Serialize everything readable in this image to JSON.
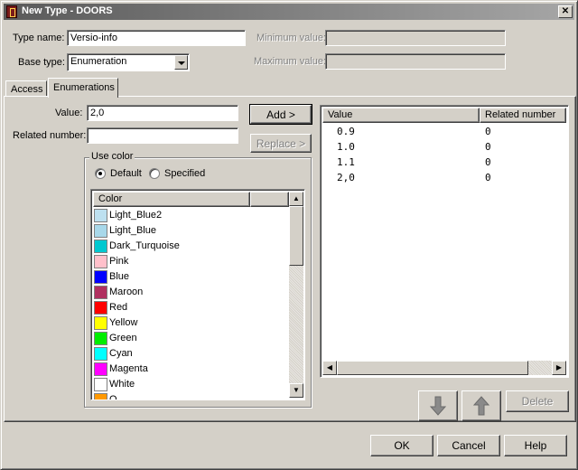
{
  "window": {
    "title": "New Type - DOORS",
    "close_glyph": "✕"
  },
  "form": {
    "type_name_label": "Type name:",
    "type_name_value": "Versio-info",
    "base_type_label": "Base type:",
    "base_type_value": "Enumeration",
    "minimum_label": "Minimum value:",
    "minimum_value": "",
    "maximum_label": "Maximum value:",
    "maximum_value": ""
  },
  "tabs": [
    {
      "label": "Access",
      "active": false
    },
    {
      "label": "Enumerations",
      "active": true
    }
  ],
  "enum": {
    "value_label": "Value:",
    "value_input": "2,0",
    "related_label": "Related number:",
    "related_input": "",
    "add_button": "Add >",
    "replace_button": "Replace >",
    "use_color": {
      "title": "Use color",
      "default_label": "Default",
      "specified_label": "Specified",
      "selected": "Default"
    },
    "color_list": {
      "header": "Color",
      "items": [
        {
          "name": "Light_Blue2",
          "color": "#bde0f0"
        },
        {
          "name": "Light_Blue",
          "color": "#a8d8ea"
        },
        {
          "name": "Dark_Turquoise",
          "color": "#00c8d0"
        },
        {
          "name": "Pink",
          "color": "#ffc0cb"
        },
        {
          "name": "Blue",
          "color": "#0000ff"
        },
        {
          "name": "Maroon",
          "color": "#b03060"
        },
        {
          "name": "Red",
          "color": "#ff0000"
        },
        {
          "name": "Yellow",
          "color": "#ffff00"
        },
        {
          "name": "Green",
          "color": "#00ee00"
        },
        {
          "name": "Cyan",
          "color": "#00ffff"
        },
        {
          "name": "Magenta",
          "color": "#ff00ff"
        },
        {
          "name": "White",
          "color": "#ffffff"
        },
        {
          "name": "O",
          "color": "#ff9900"
        }
      ]
    },
    "values_table": {
      "col_value": "Value",
      "col_related": "Related number",
      "rows": [
        {
          "value": "0.9",
          "related": "0"
        },
        {
          "value": "1.0",
          "related": "0"
        },
        {
          "value": "1.1",
          "related": "0"
        },
        {
          "value": "2,0",
          "related": "0"
        }
      ]
    },
    "move_down_icon": "arrow-down-icon",
    "move_up_icon": "arrow-up-icon",
    "delete_button": "Delete"
  },
  "footer": {
    "ok": "OK",
    "cancel": "Cancel",
    "help": "Help"
  }
}
